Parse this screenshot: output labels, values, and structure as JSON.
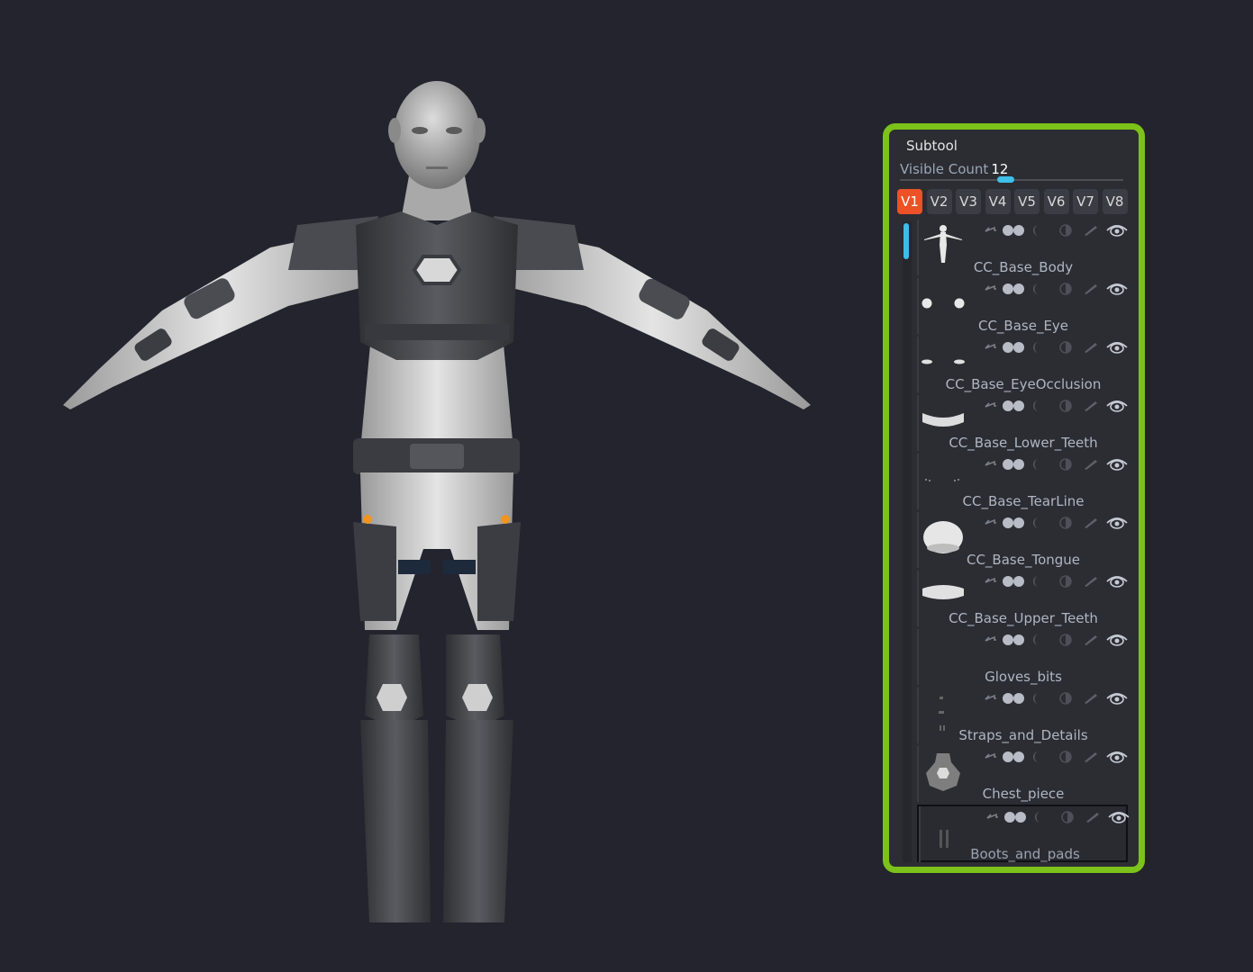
{
  "subtool": {
    "title": "Subtool",
    "visible_count_label": "Visible Count",
    "visible_count_value": "12",
    "version_tabs": [
      "V1",
      "V2",
      "V3",
      "V4",
      "V5",
      "V6",
      "V7",
      "V8"
    ],
    "active_tab": "V1",
    "items": [
      {
        "name": "CC_Base_Body",
        "thumb": "body-figure-icon"
      },
      {
        "name": "CC_Base_Eye",
        "thumb": "eyes-icon"
      },
      {
        "name": "CC_Base_EyeOcclusion",
        "thumb": "eye-occlusion-icon"
      },
      {
        "name": "CC_Base_Lower_Teeth",
        "thumb": "lower-teeth-icon"
      },
      {
        "name": "CC_Base_TearLine",
        "thumb": "tearline-icon"
      },
      {
        "name": "CC_Base_Tongue",
        "thumb": "tongue-icon"
      },
      {
        "name": "CC_Base_Upper_Teeth",
        "thumb": "upper-teeth-icon"
      },
      {
        "name": "Gloves_bits",
        "thumb": "gloves-icon"
      },
      {
        "name": "Straps_and_Details",
        "thumb": "straps-icon"
      },
      {
        "name": "Chest_piece",
        "thumb": "chest-piece-icon"
      },
      {
        "name": "Boots_and_pads",
        "thumb": "boots-icon",
        "selected": true
      }
    ]
  },
  "colors": {
    "background": "#23242d",
    "panel_border": "#7cc21a",
    "active_tab": "#ec5128",
    "slider_accent": "#3ec0e8",
    "transpose_dot": "#f0951f"
  }
}
